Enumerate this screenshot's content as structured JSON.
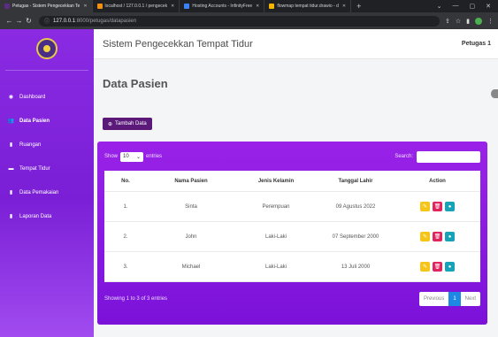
{
  "browser": {
    "tabs": [
      {
        "label": "Petugas - Sistem Pengecekkan Te",
        "color": "#5b2c83"
      },
      {
        "label": "localhost / 127.0.0.1 / pengecek",
        "color": "#f29111"
      },
      {
        "label": "Hosting Accounts - InfinityFree",
        "color": "#3b82f6"
      },
      {
        "label": "flowmap tempat tidur.drawio - d",
        "color": "#f5b400"
      }
    ],
    "url_host": "127.0.0.1",
    "url_path": ":8000/petugas/datapasien"
  },
  "app": {
    "brand": "Sistem Pengecekkan Tempat Tidur",
    "user": "Petugas 1"
  },
  "sidebar": {
    "items": [
      {
        "label": "Dashboard",
        "icon": "dashboard-icon",
        "glyph": "◉",
        "active": false
      },
      {
        "label": "Data Pasien",
        "icon": "users-icon",
        "glyph": "👥",
        "active": true
      },
      {
        "label": "Ruangan",
        "icon": "building-icon",
        "glyph": "▮",
        "active": false
      },
      {
        "label": "Tempat Tidur",
        "icon": "bed-icon",
        "glyph": "▬",
        "active": false
      },
      {
        "label": "Data Pemakaian",
        "icon": "file-icon",
        "glyph": "▮",
        "active": false
      },
      {
        "label": "Laporan Data",
        "icon": "report-icon",
        "glyph": "▮",
        "active": false
      }
    ]
  },
  "page": {
    "title": "Data Pasien",
    "add_button": "Tambah Data"
  },
  "table": {
    "show_label": "Show",
    "entries_value": "10",
    "entries_label": "entries",
    "search_label": "Search:",
    "headers": {
      "no": "No.",
      "nama": "Nama Pasien",
      "jk": "Jenis Kelamin",
      "tgl": "Tanggal Lahir",
      "aksi": "Action"
    },
    "rows": [
      {
        "no": "1.",
        "nama": "Sinta",
        "jk": "Perempuan",
        "tgl": "09 Agustus 2022"
      },
      {
        "no": "2.",
        "nama": "John",
        "jk": "Laki-Laki",
        "tgl": "07 September 2000"
      },
      {
        "no": "3.",
        "nama": "Michael",
        "jk": "Laki-Laki",
        "tgl": "13 Juli 2000"
      }
    ],
    "info": "Showing 1 to 3 of 3 entries",
    "pager": {
      "prev": "Previous",
      "page": "1",
      "next": "Next"
    }
  },
  "colors": {
    "sidebar": "#8a2be2",
    "card": "#9a22e8",
    "add_button": "#5b1a7a",
    "edit": "#f5c518",
    "delete": "#e0245e",
    "view": "#17a2b8",
    "pager_active": "#1e88e5"
  }
}
